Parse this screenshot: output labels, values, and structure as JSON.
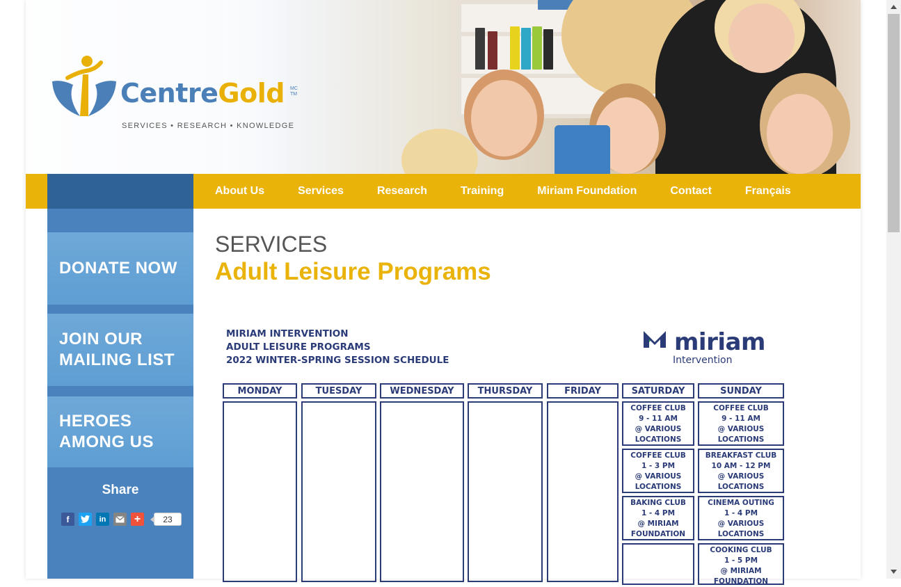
{
  "logo": {
    "brand_part1": "Centre",
    "brand_part2": "Gold",
    "trademark": "MC\nTM",
    "tagline": "SERVICES • RESEARCH • KNOWLEDGE"
  },
  "nav": {
    "items": [
      "About Us",
      "Services",
      "Research",
      "Training",
      "Miriam Foundation",
      "Contact",
      "Français"
    ]
  },
  "sidebar": {
    "buttons": [
      "DONATE NOW",
      "JOIN OUR\nMAILING LIST",
      "HEROES\nAMONG US"
    ],
    "share_title": "Share",
    "share_icons": [
      "facebook-icon",
      "twitter-icon",
      "linkedin-icon",
      "email-icon",
      "plus-icon"
    ],
    "share_count": "23"
  },
  "content": {
    "section_label": "SERVICES",
    "page_title": "Adult Leisure Programs"
  },
  "schedule": {
    "heading_line1": "MIRIAM INTERVENTION",
    "heading_line2": "ADULT LEISURE PROGRAMS",
    "heading_line3": "2022 WINTER-SPRING SESSION SCHEDULE",
    "logo_word": "miriam",
    "logo_sub": "Intervention",
    "days": [
      "MONDAY",
      "TUESDAY",
      "WEDNESDAY",
      "THURSDAY",
      "FRIDAY",
      "SATURDAY",
      "SUNDAY"
    ],
    "saturday": [
      "COFFEE CLUB\n9 - 11 AM\n@ VARIOUS\nLOCATIONS",
      "COFFEE CLUB\n1 - 3 PM\n@ VARIOUS\nLOCATIONS",
      "BAKING CLUB\n1 - 4 PM\n@ MIRIAM\nFOUNDATION",
      ""
    ],
    "sunday": [
      "COFFEE CLUB\n9 - 11 AM\n@ VARIOUS\nLOCATIONS",
      "BREAKFAST CLUB\n10 AM - 12 PM\n@ VARIOUS\nLOCATIONS",
      "CINEMA OUTING\n1 - 4 PM\n@ VARIOUS\nLOCATIONS",
      "COOKING CLUB\n1 - 5 PM\n@ MIRIAM\nFOUNDATION"
    ]
  }
}
